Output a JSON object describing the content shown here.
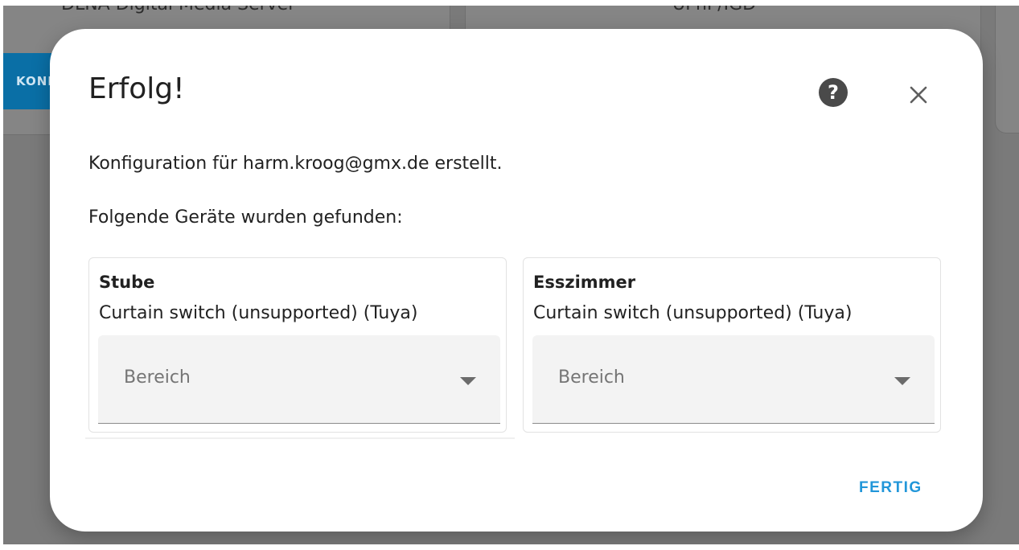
{
  "background": {
    "left_card_title": "DLNA Digital Media Server",
    "mid_card_title": "UPnP/IGD",
    "configure_button_label": "KONFIGURIEREN"
  },
  "dialog": {
    "title": "Erfolg!",
    "help_icon_glyph": "?",
    "close_icon": "close-icon",
    "message_created": "Konfiguration für harm.kroog@gmx.de erstellt.",
    "message_found": "Folgende Geräte wurden gefunden:",
    "devices": [
      {
        "name": "Stube",
        "model": "Curtain switch (unsupported) (Tuya)",
        "area_label": "Bereich"
      },
      {
        "name": "Esszimmer",
        "model": "Curtain switch (unsupported) (Tuya)",
        "area_label": "Bereich"
      }
    ],
    "done_label": "FERTIG"
  },
  "colors": {
    "accent": "#2196d9",
    "overlay": "#7a7a7a",
    "configure_button": "#0a6fa6"
  }
}
